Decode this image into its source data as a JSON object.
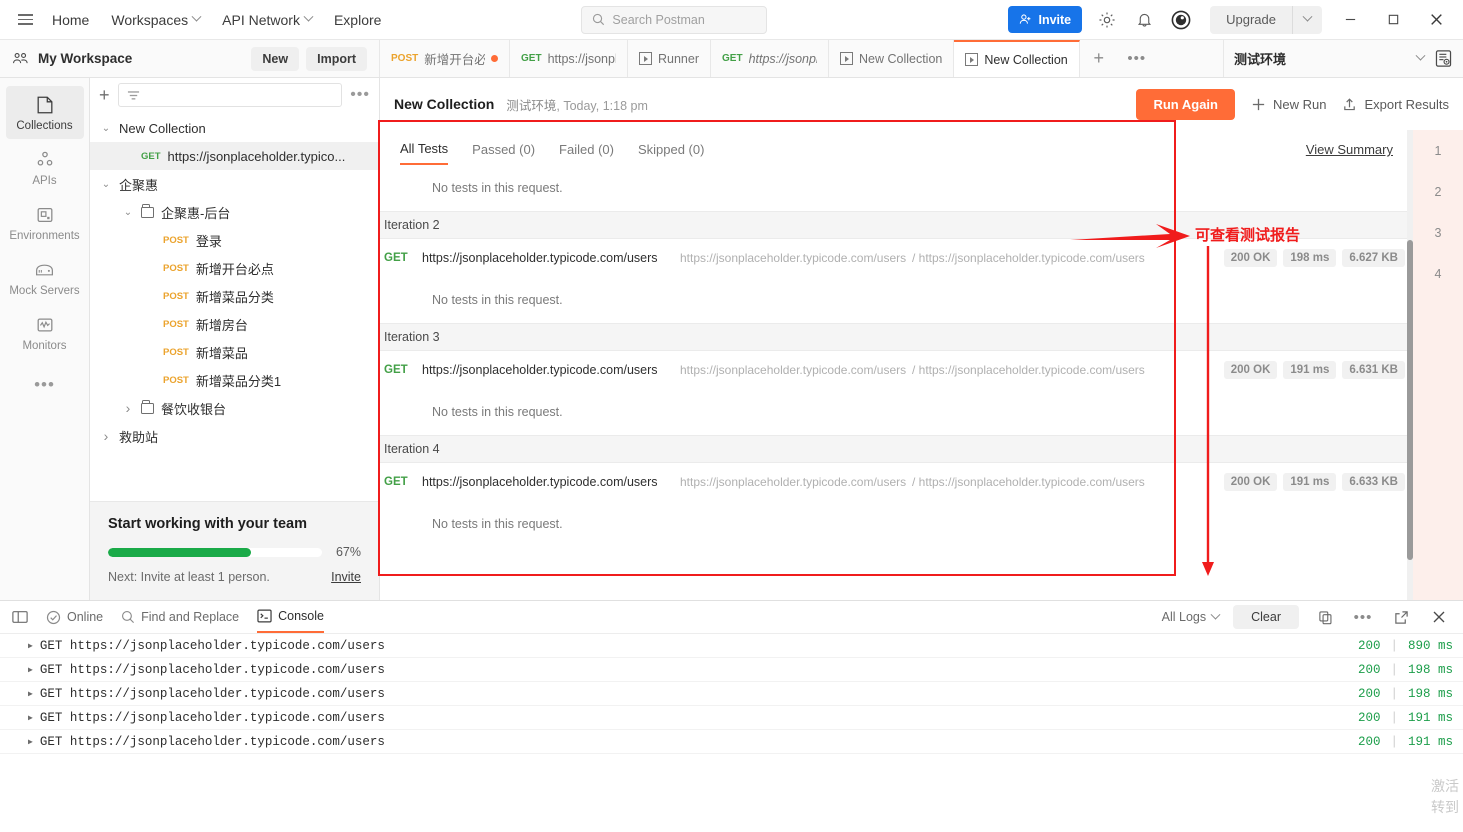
{
  "topbar": {
    "menu_icon": "hamburger-icon",
    "nav": [
      {
        "label": "Home",
        "caret": false
      },
      {
        "label": "Workspaces",
        "caret": true
      },
      {
        "label": "API Network",
        "caret": true
      },
      {
        "label": "Explore",
        "caret": false
      }
    ],
    "search_placeholder": "Search Postman",
    "invite_label": "Invite",
    "upgrade_label": "Upgrade",
    "icons": [
      "search-icon",
      "gear-icon",
      "bell-icon",
      "postman-avatar-icon",
      "minimize-icon",
      "maximize-icon",
      "close-icon"
    ]
  },
  "workspace": {
    "name": "My Workspace",
    "new_label": "New",
    "import_label": "Import"
  },
  "tabs": [
    {
      "verb": "POST",
      "title": "新增开台必点",
      "unsaved": true,
      "active": false,
      "type": "request",
      "italic": false
    },
    {
      "verb": "GET",
      "title": "https://jsonplac",
      "unsaved": false,
      "active": false,
      "type": "request",
      "italic": false
    },
    {
      "verb": "",
      "title": "Runner",
      "unsaved": false,
      "active": false,
      "type": "runner",
      "italic": false
    },
    {
      "verb": "GET",
      "title": "https://jsonplac",
      "unsaved": false,
      "active": false,
      "type": "request",
      "italic": true
    },
    {
      "verb": "",
      "title": "New Collection",
      "unsaved": false,
      "active": false,
      "type": "runner",
      "italic": false
    },
    {
      "verb": "",
      "title": "New Collection",
      "unsaved": false,
      "active": true,
      "type": "runner",
      "italic": false
    }
  ],
  "tab_controls": {
    "add": "+",
    "more": "•••"
  },
  "environment": {
    "name": "测试环境",
    "chevron": "chevron-down-icon",
    "eye_icon": "environment-quick-look-icon"
  },
  "rail": [
    {
      "label": "Collections",
      "icon": "collections-icon",
      "active": true
    },
    {
      "label": "APIs",
      "icon": "apis-icon",
      "active": false
    },
    {
      "label": "Environments",
      "icon": "environments-icon",
      "active": false
    },
    {
      "label": "Mock Servers",
      "icon": "mock-servers-icon",
      "active": false
    },
    {
      "label": "Monitors",
      "icon": "monitors-icon",
      "active": false
    }
  ],
  "sidebar": {
    "filter_placeholder": "",
    "tree": [
      {
        "indent": 0,
        "chev": "down",
        "label": "New Collection",
        "method": "",
        "kind": "collection",
        "selected": false
      },
      {
        "indent": 1,
        "chev": "",
        "label": "https://jsonplaceholder.typico...",
        "method": "GET",
        "kind": "request",
        "selected": true
      },
      {
        "indent": 0,
        "chev": "down",
        "label": "企聚惠",
        "method": "",
        "kind": "collection",
        "selected": false
      },
      {
        "indent": 1,
        "chev": "down",
        "label": "企聚惠-后台",
        "method": "",
        "kind": "folder",
        "selected": false
      },
      {
        "indent": 2,
        "chev": "",
        "label": "登录",
        "method": "POST",
        "kind": "request",
        "selected": false
      },
      {
        "indent": 2,
        "chev": "",
        "label": "新增开台必点",
        "method": "POST",
        "kind": "request",
        "selected": false
      },
      {
        "indent": 2,
        "chev": "",
        "label": "新增菜品分类",
        "method": "POST",
        "kind": "request",
        "selected": false
      },
      {
        "indent": 2,
        "chev": "",
        "label": "新增房台",
        "method": "POST",
        "kind": "request",
        "selected": false
      },
      {
        "indent": 2,
        "chev": "",
        "label": "新增菜品",
        "method": "POST",
        "kind": "request",
        "selected": false
      },
      {
        "indent": 2,
        "chev": "",
        "label": "新增菜品分类1",
        "method": "POST",
        "kind": "request",
        "selected": false
      },
      {
        "indent": 1,
        "chev": "right",
        "label": "餐饮收银台",
        "method": "",
        "kind": "folder",
        "selected": false
      },
      {
        "indent": 0,
        "chev": "right",
        "label": "救助站",
        "method": "",
        "kind": "collection",
        "selected": false
      }
    ],
    "team_card": {
      "title": "Start working with your team",
      "progress_pct": "67%",
      "progress_value": 67,
      "next_text": "Next: Invite at least 1 person.",
      "invite_label": "Invite"
    }
  },
  "run_header": {
    "collection": "New Collection",
    "environment": "测试环境",
    "timestamp": "Today, 1:18 pm",
    "run_again_label": "Run Again",
    "new_run_label": "New Run",
    "export_label": "Export Results"
  },
  "results": {
    "tabs": [
      {
        "label": "All Tests",
        "active": true
      },
      {
        "label": "Passed (0)",
        "active": false
      },
      {
        "label": "Failed (0)",
        "active": false
      },
      {
        "label": "Skipped (0)",
        "active": false
      }
    ],
    "view_summary_label": "View Summary",
    "no_tests_text": "No tests in this request.",
    "iteration_numbers": [
      "1",
      "2",
      "3",
      "4"
    ],
    "blocks": [
      {
        "header": "",
        "requests": [],
        "trailing_note": "No tests in this request."
      },
      {
        "header": "Iteration 2",
        "requests": [
          {
            "verb": "GET",
            "name": "https://jsonplaceholder.typicode.com/users",
            "url": "https://jsonplaceholder.typicode.com/users",
            "path": "/ https://jsonplaceholder.typicode.com/users",
            "status": "200 OK",
            "time": "198 ms",
            "size": "6.627 KB"
          }
        ],
        "trailing_note": "No tests in this request."
      },
      {
        "header": "Iteration 3",
        "requests": [
          {
            "verb": "GET",
            "name": "https://jsonplaceholder.typicode.com/users",
            "url": "https://jsonplaceholder.typicode.com/users",
            "path": "/ https://jsonplaceholder.typicode.com/users",
            "status": "200 OK",
            "time": "191 ms",
            "size": "6.631 KB"
          }
        ],
        "trailing_note": "No tests in this request."
      },
      {
        "header": "Iteration 4",
        "requests": [
          {
            "verb": "GET",
            "name": "https://jsonplaceholder.typicode.com/users",
            "url": "https://jsonplaceholder.typicode.com/users",
            "path": "/ https://jsonplaceholder.typicode.com/users",
            "status": "200 OK",
            "time": "191 ms",
            "size": "6.633 KB"
          }
        ],
        "trailing_note": "No tests in this request."
      }
    ]
  },
  "annotation": {
    "text": "可查看测试报告",
    "color": "#f01c1c"
  },
  "console": {
    "left_items": [
      {
        "label": "Online",
        "icon": "check-circle-icon"
      },
      {
        "label": "Find and Replace",
        "icon": "search-icon"
      },
      {
        "label": "Console",
        "icon": "console-icon",
        "active": true
      }
    ],
    "sidebar_toggle_icon": "sidebar-toggle-icon",
    "filter_label": "All Logs",
    "clear_label": "Clear",
    "right_icons": [
      "copy-icon",
      "more-icon",
      "popout-icon",
      "close-icon"
    ],
    "logs": [
      {
        "method": "GET",
        "url": "https://jsonplaceholder.typicode.com/users",
        "status": "200",
        "time": "890 ms"
      },
      {
        "method": "GET",
        "url": "https://jsonplaceholder.typicode.com/users",
        "status": "200",
        "time": "198 ms"
      },
      {
        "method": "GET",
        "url": "https://jsonplaceholder.typicode.com/users",
        "status": "200",
        "time": "198 ms"
      },
      {
        "method": "GET",
        "url": "https://jsonplaceholder.typicode.com/users",
        "status": "200",
        "time": "191 ms"
      },
      {
        "method": "GET",
        "url": "https://jsonplaceholder.typicode.com/users",
        "status": "200",
        "time": "191 ms"
      }
    ]
  },
  "watermark": {
    "line1": "激活",
    "line2": "转到"
  },
  "colors": {
    "accent": "#ff6c37",
    "invite": "#1774e9",
    "success": "#1aaa48",
    "annotation": "#f01c1c",
    "get": "#43a047",
    "post": "#eba32d"
  }
}
